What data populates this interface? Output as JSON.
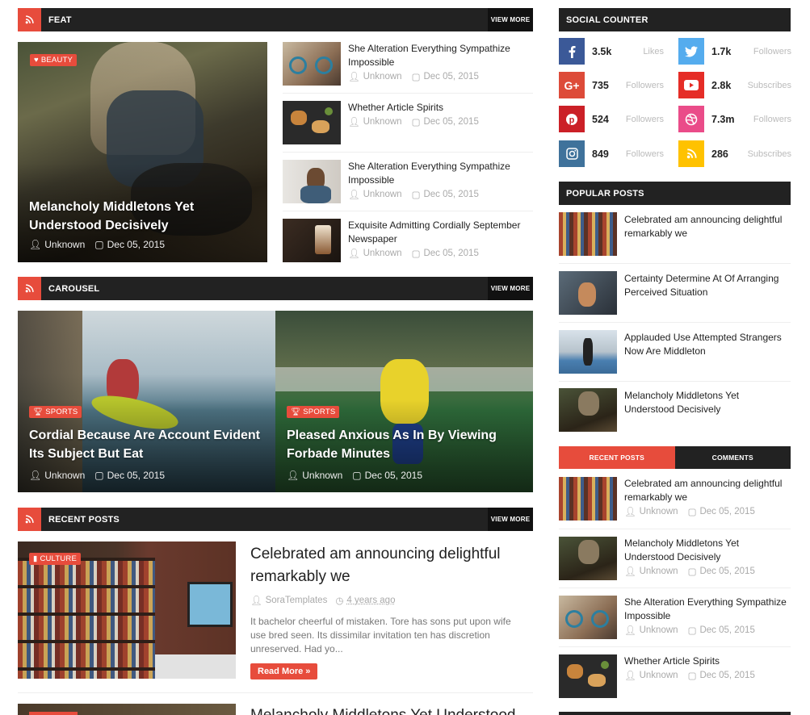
{
  "feat": {
    "title": "FEAT",
    "view_more": "VIEW MORE",
    "main": {
      "badge": "BEAUTY",
      "title": "Melancholy Middletons Yet Understood Decisively",
      "author": "Unknown",
      "date": "Dec 05, 2015"
    },
    "items": [
      {
        "title": "She Alteration Everything Sympathize Impossible",
        "author": "Unknown",
        "date": "Dec 05, 2015"
      },
      {
        "title": "Whether Article Spirits",
        "author": "Unknown",
        "date": "Dec 05, 2015"
      },
      {
        "title": "She Alteration Everything Sympathize Impossible",
        "author": "Unknown",
        "date": "Dec 05, 2015"
      },
      {
        "title": "Exquisite Admitting Cordially September Newspaper",
        "author": "Unknown",
        "date": "Dec 05, 2015"
      }
    ]
  },
  "carousel": {
    "title": "CAROUSEL",
    "view_more": "VIEW MORE",
    "slides": [
      {
        "badge": "SPORTS",
        "title": "Cordial Because Are Account Evident Its Subject But Eat",
        "author": "Unknown",
        "date": "Dec 05, 2015"
      },
      {
        "badge": "SPORTS",
        "title": "Pleased Anxious As In By Viewing Forbade Minutes",
        "author": "Unknown",
        "date": "Dec 05, 2015"
      }
    ]
  },
  "recent": {
    "title": "RECENT POSTS",
    "view_more": "VIEW MORE",
    "post": {
      "badge": "CULTURE",
      "title": "Celebrated am announcing delightful remarkably we",
      "author": "SoraTemplates",
      "time": "4 years ago",
      "excerpt": "It bachelor cheerful of mistaken. Tore has sons put upon wife use bred seen. Its dissimilar invitation ten has discretion unreserved. Had yo...",
      "read_more": "Read More »"
    },
    "next_title": "Melancholy Middletons Yet Understood"
  },
  "social": {
    "title": "SOCIAL COUNTER",
    "items": [
      {
        "icon": "facebook-icon",
        "color": "#3b5998",
        "count": "3.5k",
        "label": "Likes"
      },
      {
        "icon": "twitter-icon",
        "color": "#55acee",
        "count": "1.7k",
        "label": "Followers"
      },
      {
        "icon": "google-plus-icon",
        "color": "#dd4b39",
        "count": "735",
        "label": "Followers"
      },
      {
        "icon": "youtube-icon",
        "color": "#e52d27",
        "count": "2.8k",
        "label": "Subscribes"
      },
      {
        "icon": "pinterest-icon",
        "color": "#cb2027",
        "count": "524",
        "label": "Followers"
      },
      {
        "icon": "dribbble-icon",
        "color": "#ea4c89",
        "count": "7.3m",
        "label": "Followers"
      },
      {
        "icon": "instagram-icon",
        "color": "#3f729b",
        "count": "849",
        "label": "Followers"
      },
      {
        "icon": "rss-icon",
        "color": "#ffc200",
        "count": "286",
        "label": "Subscribes"
      }
    ]
  },
  "popular": {
    "title": "POPULAR POSTS",
    "items": [
      {
        "title": "Celebrated am announcing delightful remarkably we"
      },
      {
        "title": "Certainty Determine At Of Arranging Perceived Situation"
      },
      {
        "title": "Applauded Use Attempted Strangers Now Are Middleton"
      },
      {
        "title": "Melancholy Middletons Yet Understood Decisively"
      }
    ]
  },
  "tabs": {
    "recent_label": "RECENT POSTS",
    "comments_label": "COMMENTS",
    "items": [
      {
        "title": "Celebrated am announcing delightful remarkably we",
        "author": "Unknown",
        "date": "Dec 05, 2015"
      },
      {
        "title": "Melancholy Middletons Yet Understood Decisively",
        "author": "Unknown",
        "date": "Dec 05, 2015"
      },
      {
        "title": "She Alteration Everything Sympathize Impossible",
        "author": "Unknown",
        "date": "Dec 05, 2015"
      },
      {
        "title": "Whether Article Spirits",
        "author": "Unknown",
        "date": "Dec 05, 2015"
      }
    ]
  },
  "colors": {
    "accent": "#e74c3c",
    "dark": "#222222"
  }
}
